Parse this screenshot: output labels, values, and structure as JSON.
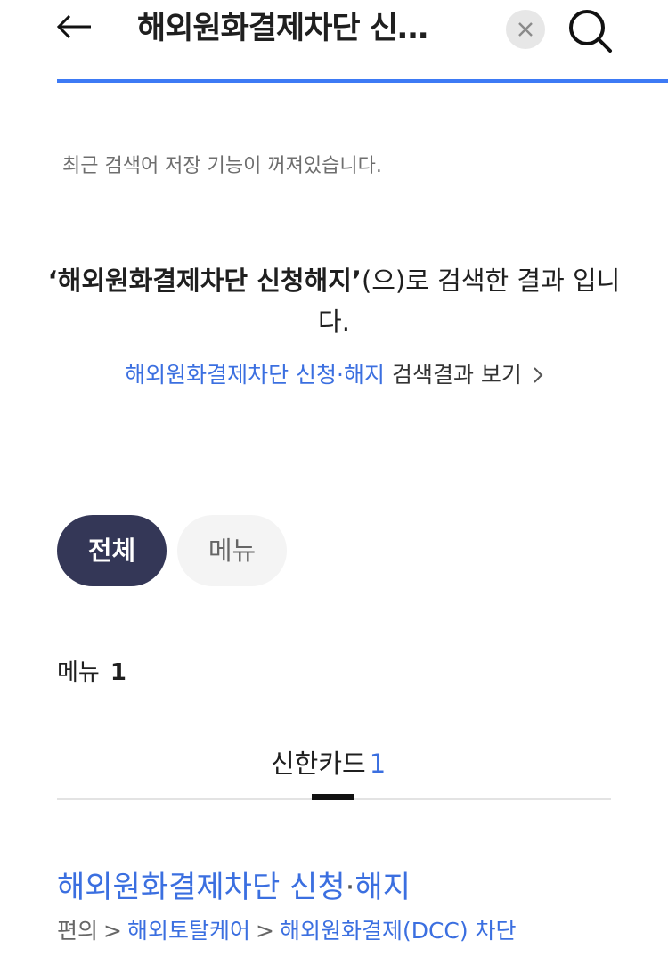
{
  "header": {
    "query_text": "해외원화결제차단 신…",
    "icons": {
      "back": "arrow-left-icon",
      "clear": "close-icon",
      "search": "search-icon"
    },
    "accent_color": "#3d7af5"
  },
  "notice": "최근 검색어 저장 기능이 꺼져있습니다.",
  "result_message": {
    "query": "‘해외원화결제차단 신청해지’",
    "suffix": "(으)로 검색한 결과 입니다."
  },
  "suggestion": {
    "keyword": "해외원화결제차단 신청·해지",
    "suffix": " 검색결과 보기",
    "icon": "chevron-right-icon"
  },
  "filters": {
    "all": "전체",
    "menu": "메뉴",
    "active": "전체"
  },
  "section": {
    "label": "메뉴",
    "count": "1"
  },
  "tabs": [
    {
      "label": "신한카드",
      "count": "1",
      "active": true
    }
  ],
  "result": {
    "title_part1": "해외원화결제차단 신청",
    "title_sep": "·",
    "title_part2": "해지",
    "breadcrumb": [
      {
        "label": "편의",
        "link": false
      },
      {
        "label": "해외토탈케어",
        "link": true
      },
      {
        "label": "해외원화결제(DCC) 차단",
        "link": true
      }
    ],
    "breadcrumb_sep": ">"
  }
}
